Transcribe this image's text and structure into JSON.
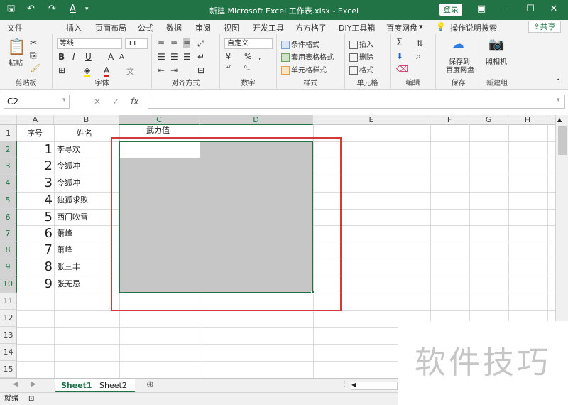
{
  "titlebar": {
    "title": "新建 Microsoft Excel 工作表.xlsx  -  Excel",
    "login": "登录",
    "save_icon": "save-icon",
    "undo_icon": "undo-icon",
    "redo_icon": "redo-icon",
    "color": "#217346"
  },
  "tabs": [
    "文件",
    "开始",
    "插入",
    "页面布局",
    "公式",
    "数据",
    "审阅",
    "视图",
    "开发工具",
    "方方格子",
    "DIY工具箱",
    "百度网盘"
  ],
  "active_tab": "开始",
  "tellme": "操作说明搜索",
  "share": "共享",
  "ribbon": {
    "clipboard": {
      "label": "剪贴板",
      "paste": "粘贴"
    },
    "font": {
      "label": "字体",
      "name": "等线",
      "size": "11",
      "bold": "B",
      "italic": "I",
      "underline": "U",
      "grow": "A",
      "shrink": "A"
    },
    "align": {
      "label": "对齐方式"
    },
    "number": {
      "label": "数字",
      "format": "自定义",
      "percent": "%",
      "comma": ","
    },
    "styles": {
      "label": "样式",
      "cond": "条件格式",
      "table": "套用表格格式",
      "cell": "单元格样式"
    },
    "cells": {
      "label": "单元格",
      "insert": "插入",
      "delete": "删除",
      "format": "格式"
    },
    "edit": {
      "label": "编辑",
      "sum": "Σ"
    },
    "save": {
      "label": "保存",
      "btn1": "保存到",
      "btn2": "百度网盘"
    },
    "newgroup": {
      "label": "新建组",
      "btn": "照相机"
    }
  },
  "formula": {
    "namebox": "C2",
    "cancel": "✕",
    "enter": "✓",
    "fx": "fx",
    "value": ""
  },
  "columns": [
    "A",
    "B",
    "C",
    "D",
    "E",
    "F",
    "G",
    "H"
  ],
  "rows": [
    "1",
    "2",
    "3",
    "4",
    "5",
    "6",
    "7",
    "8",
    "9",
    "10",
    "11",
    "12",
    "13",
    "14",
    "15"
  ],
  "headers": {
    "a": "序号",
    "b": "姓名",
    "c": "武力值"
  },
  "data": [
    {
      "seq": "1",
      "name": "李寻欢"
    },
    {
      "seq": "2",
      "name": "令狐冲"
    },
    {
      "seq": "3",
      "name": "令狐冲"
    },
    {
      "seq": "4",
      "name": "独孤求败"
    },
    {
      "seq": "5",
      "name": "西门吹雪"
    },
    {
      "seq": "6",
      "name": "萧峰"
    },
    {
      "seq": "7",
      "name": "萧峰"
    },
    {
      "seq": "8",
      "name": "张三丰"
    },
    {
      "seq": "9",
      "name": "张无忌"
    }
  ],
  "sheets": [
    "Sheet1",
    "Sheet2"
  ],
  "add_sheet": "⊕",
  "status": "就绪",
  "watermark": "软件技巧"
}
